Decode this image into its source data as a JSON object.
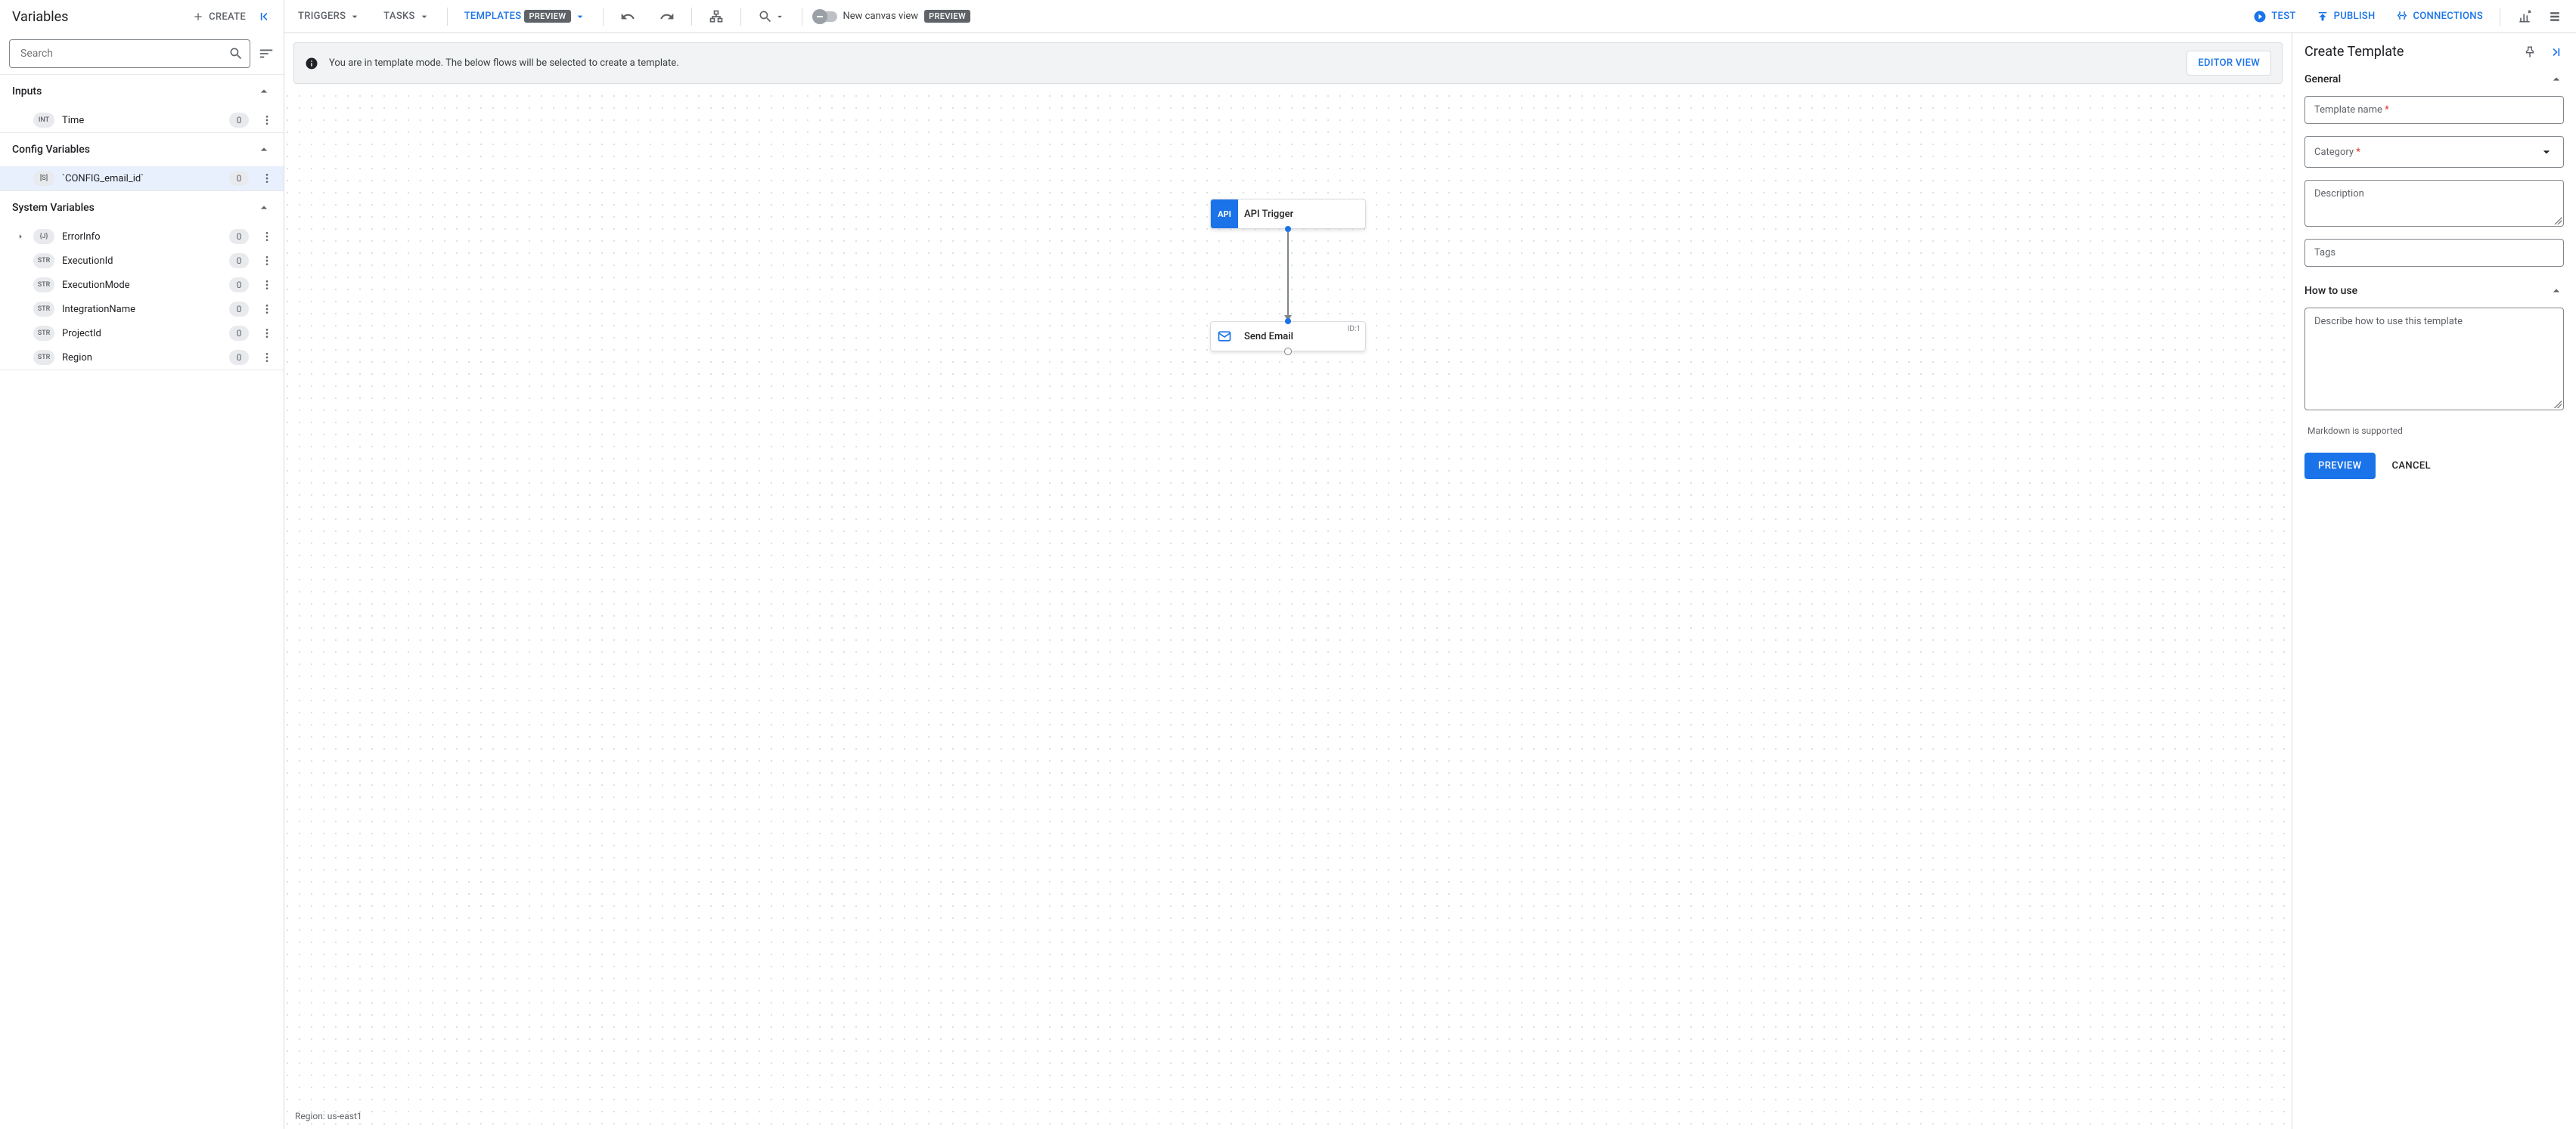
{
  "sidebar": {
    "title": "Variables",
    "create_label": "CREATE",
    "search_placeholder": "Search",
    "sections": {
      "inputs": {
        "title": "Inputs",
        "items": [
          {
            "type": "INT",
            "name": "Time",
            "refs": "0"
          }
        ]
      },
      "config": {
        "title": "Config Variables",
        "items": [
          {
            "type": "[S]",
            "name": "`CONFIG_email_id`",
            "refs": "0"
          }
        ]
      },
      "system": {
        "title": "System Variables",
        "items": [
          {
            "type": "{J}",
            "name": "ErrorInfo",
            "refs": "0",
            "expandable": true
          },
          {
            "type": "STR",
            "name": "ExecutionId",
            "refs": "0"
          },
          {
            "type": "STR",
            "name": "ExecutionMode",
            "refs": "0"
          },
          {
            "type": "STR",
            "name": "IntegrationName",
            "refs": "0"
          },
          {
            "type": "STR",
            "name": "ProjectId",
            "refs": "0"
          },
          {
            "type": "STR",
            "name": "Region",
            "refs": "0"
          }
        ]
      }
    }
  },
  "toolbar": {
    "triggers": "TRIGGERS",
    "tasks": "TASKS",
    "templates": "TEMPLATES",
    "preview_badge": "PREVIEW",
    "new_canvas": "New canvas view",
    "test": "TEST",
    "publish": "PUBLISH",
    "connections": "CONNECTIONS"
  },
  "canvas": {
    "info_text": "You are in template mode. The below flows will be selected to create a template.",
    "editor_view": "EDITOR VIEW",
    "node1_label": "API Trigger",
    "node1_accent": "API",
    "node2_label": "Send Email",
    "node2_id": "ID:1",
    "region_label": "Region: us-east1"
  },
  "right": {
    "title": "Create Template",
    "general": "General",
    "template_name_label": "Template name ",
    "category_label": "Category ",
    "description_label": "Description",
    "tags_label": "Tags",
    "howto": "How to use",
    "howto_placeholder": "Describe how to use this template",
    "hint": "Markdown is supported",
    "preview": "PREVIEW",
    "cancel": "CANCEL",
    "asterisk": "*"
  }
}
